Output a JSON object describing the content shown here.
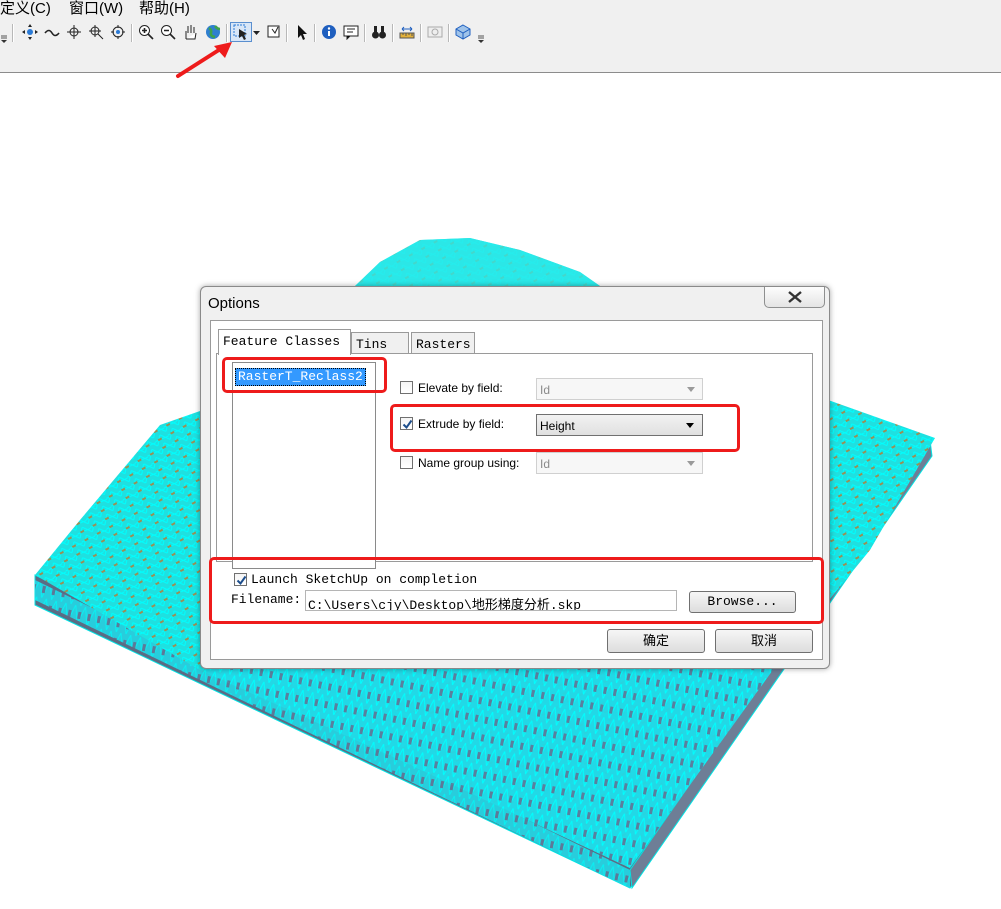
{
  "menu": {
    "items": [
      "定义(C)",
      "窗口(W)",
      "帮助(H)"
    ]
  },
  "toolbar": {
    "buttons": [
      {
        "icon": "pan-navigate-icon"
      },
      {
        "icon": "fly-icon"
      },
      {
        "icon": "target-center-icon"
      },
      {
        "icon": "zoom-to-target-icon"
      },
      {
        "icon": "set-observer-icon"
      },
      {
        "icon": "zoom-in-icon"
      },
      {
        "icon": "zoom-out-icon"
      },
      {
        "icon": "pan-hand-icon"
      },
      {
        "icon": "full-extent-globe-icon"
      },
      {
        "icon": "export-sketchup-icon"
      },
      {
        "icon": "select-features-icon"
      },
      {
        "icon": "select-arrow-icon"
      },
      {
        "icon": "identify-icon"
      },
      {
        "icon": "html-popup-icon"
      },
      {
        "icon": "find-binoculars-icon"
      },
      {
        "icon": "measure-icon"
      },
      {
        "icon": "time-slider-icon"
      },
      {
        "icon": "3d-effects-icon"
      }
    ]
  },
  "dialog": {
    "title": "Options",
    "tabs": [
      "Feature Classes",
      "Tins",
      "Rasters"
    ],
    "active_tab": "Feature Classes",
    "feature_classes": [
      "RasterT_Reclass2"
    ],
    "options": {
      "elevate": {
        "label": "Elevate by field:",
        "checked": false,
        "value": "Id",
        "enabled": false
      },
      "extrude": {
        "label": "Extrude by field:",
        "checked": true,
        "value": "Height",
        "enabled": true
      },
      "group": {
        "label": "Name group using:",
        "checked": false,
        "value": "Id",
        "enabled": false
      }
    },
    "launch": {
      "label": "Launch SketchUp on completion",
      "checked": true
    },
    "filename": {
      "label": "Filename:",
      "value": "C:\\Users\\cjy\\Desktop\\地形梯度分析.skp"
    },
    "browse_label": "Browse...",
    "ok_label": "确定",
    "cancel_label": "取消"
  },
  "colors": {
    "annotation_red": "#ee1b1b",
    "mesh_cyan": "#00f0f0",
    "selection_blue": "#3399ff"
  }
}
